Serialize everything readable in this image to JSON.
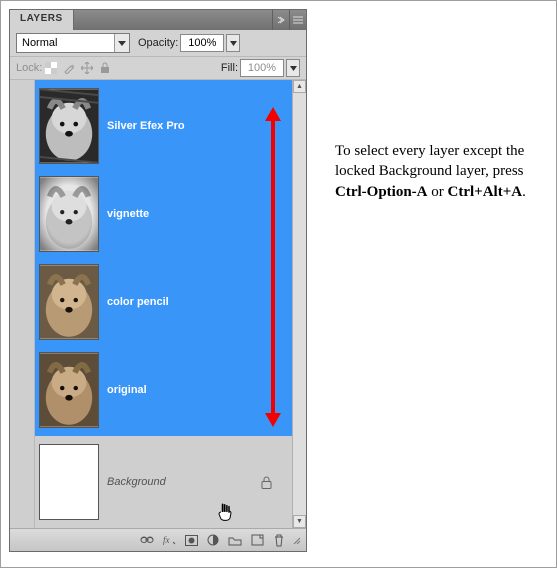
{
  "panel": {
    "title": "LAYERS",
    "blendMode": "Normal",
    "opacityLabel": "Opacity:",
    "opacityValue": "100%",
    "lockLabel": "Lock:",
    "fillLabel": "Fill:",
    "fillValue": "100%"
  },
  "layers": [
    {
      "name": "Silver Efex Pro",
      "selected": true,
      "visible": true,
      "thumb": "dog-bw1"
    },
    {
      "name": "vignette",
      "selected": true,
      "visible": true,
      "thumb": "dog-bw2"
    },
    {
      "name": "color pencil",
      "selected": true,
      "visible": true,
      "thumb": "dog-color"
    },
    {
      "name": "original",
      "selected": true,
      "visible": true,
      "thumb": "dog-color"
    },
    {
      "name": "Background",
      "selected": false,
      "visible": true,
      "thumb": "blank",
      "locked": true
    }
  ],
  "caption": {
    "t1": "To select every layer except the locked Background layer, press ",
    "k1": "Ctrl-Option-A",
    "t2": " or ",
    "k2": "Ctrl+Alt+A",
    "t3": "."
  }
}
